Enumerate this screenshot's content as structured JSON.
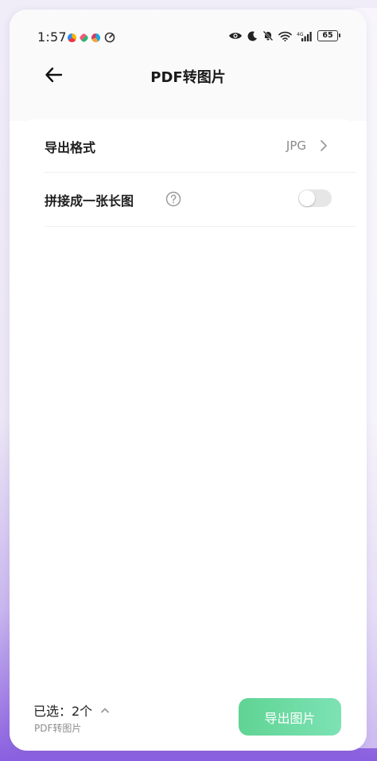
{
  "status_bar": {
    "time": "1:57",
    "battery": "65"
  },
  "header": {
    "title": "PDF转图片"
  },
  "settings": {
    "export_format_label": "导出格式",
    "export_format_value": "JPG",
    "merge_label": "拼接成一张长图",
    "merge_enabled": false
  },
  "bottom": {
    "selected_text": "已选：2个",
    "subtitle": "PDF转图片",
    "export_button": "导出图片"
  },
  "colors": {
    "accent_green": "#5fd493",
    "toggle_off": "#e6e6e6"
  }
}
